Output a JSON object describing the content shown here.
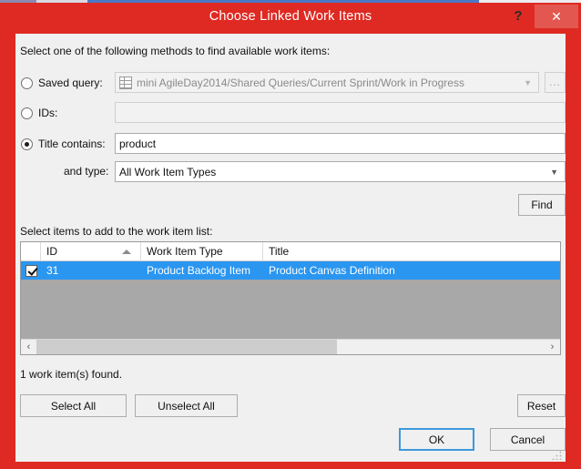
{
  "window": {
    "title": "Choose Linked Work Items",
    "help_glyph": "?",
    "close_glyph": "✕",
    "title_bar_color": "#de2a22",
    "close_button_color": "#e25850",
    "client_background": "#f0f0f0"
  },
  "instructions": {
    "methods_label": "Select one of the following methods to find available work items:",
    "list_label": "Select items to add to the work item list:"
  },
  "methods": {
    "saved_query": {
      "label": "Saved query:",
      "selected": false,
      "enabled": false,
      "value": "mini AgileDay2014/Shared Queries/Current Sprint/Work in Progress",
      "browse_label": "...",
      "dropdown_icon": "chevron-down-icon",
      "query_icon": "query-grid-icon"
    },
    "ids": {
      "label": "IDs:",
      "selected": false,
      "enabled": false,
      "value": "",
      "placeholder": ""
    },
    "title_contains": {
      "label": "Title contains:",
      "selected": true,
      "enabled": true,
      "value": "product",
      "placeholder": ""
    },
    "and_type": {
      "label": "and type:",
      "value": "All Work Item Types",
      "dropdown_icon": "chevron-down-icon",
      "options": [
        "All Work Item Types"
      ]
    }
  },
  "buttons": {
    "find": "Find",
    "select_all": "Select All",
    "unselect_all": "Unselect All",
    "reset": "Reset",
    "ok": "OK",
    "cancel": "Cancel"
  },
  "grid": {
    "columns": [
      "",
      "ID",
      "Work Item Type",
      "Title"
    ],
    "sort_column": "ID",
    "sort_direction": "ascending",
    "selection_color": "#2a96f0",
    "empty_area_color": "#a8a8a8",
    "rows": [
      {
        "checked": true,
        "id": "31",
        "work_item_type": "Product Backlog Item",
        "title": "Product Canvas Definition",
        "selected": true
      }
    ],
    "scroll": {
      "left_arrow": "‹",
      "right_arrow": "›"
    }
  },
  "status": {
    "found_text": "1 work item(s) found."
  }
}
